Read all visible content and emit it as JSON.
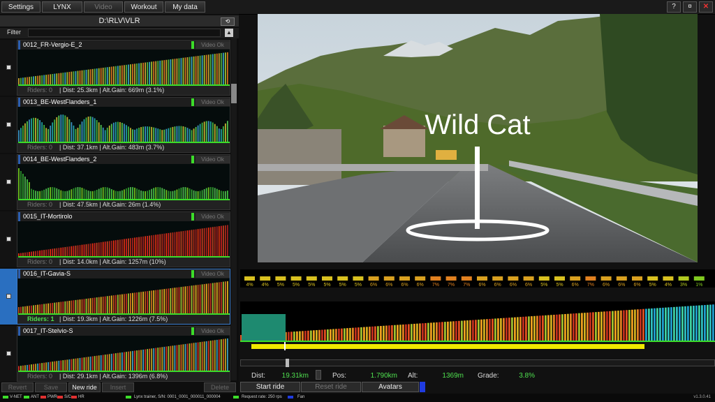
{
  "menu": {
    "settings": "Settings",
    "lynx": "LYNX",
    "video": "Video",
    "workout": "Workout",
    "mydata": "My data"
  },
  "window": {
    "help": "?",
    "minimize": "¤",
    "close": "✕"
  },
  "path": "D:\\RLV\\VLR",
  "filter": {
    "label": "Filter",
    "value": ""
  },
  "rides": [
    {
      "name": "0012_FR-Vergio-E_2",
      "video": "Video Ok",
      "riders": "Riders: 0",
      "info": "| Dist: 25.3km | Alt.Gain: 669m (3.1%)"
    },
    {
      "name": "0013_BE-WestFlanders_1",
      "video": "Video Ok",
      "riders": "Riders: 0",
      "info": "| Dist: 37.1km | Alt.Gain: 483m (3.7%)"
    },
    {
      "name": "0014_BE-WestFlanders_2",
      "video": "Video Ok",
      "riders": "Riders: 0",
      "info": "| Dist: 47.5km | Alt.Gain: 26m (1.4%)"
    },
    {
      "name": "0015_IT-Mortirolo",
      "video": "Video Ok",
      "riders": "Riders: 0",
      "info": "| Dist: 14.0km | Alt.Gain: 1257m (10%)"
    },
    {
      "name": "0016_IT-Gavia-S",
      "video": "Video Ok",
      "riders": "Riders: 1",
      "info": "| Dist: 19.3km | Alt.Gain: 1226m (7.5%)"
    },
    {
      "name": "0017_IT-Stelvio-S",
      "video": "Video Ok",
      "riders": "Riders: 0",
      "info": "| Dist: 29.1km | Alt.Gain: 1396m (6.8%)"
    }
  ],
  "bottom": {
    "revert": "Revert",
    "save": "Save",
    "newride": "New ride",
    "insert": "Insert",
    "delete": "Delete"
  },
  "status": {
    "vnet": "V-NET",
    "ant": "ANT",
    "pwr": "PWR",
    "sc": "S/C",
    "hr": "HR",
    "trainer": "Lynx trainer, S/N: 0001_0001_000011_000004",
    "rate": "Request rate: 250 rps",
    "fan": "Fan",
    "version": "v1.3.0.41"
  },
  "overlay": "Wild Cat",
  "grades": [
    "4%",
    "4%",
    "5%",
    "5%",
    "5%",
    "5%",
    "5%",
    "5%",
    "6%",
    "6%",
    "6%",
    "6%",
    "7%",
    "7%",
    "7%",
    "6%",
    "6%",
    "6%",
    "6%",
    "5%",
    "5%",
    "6%",
    "7%",
    "6%",
    "6%",
    "6%",
    "5%",
    "4%",
    "3%",
    "1%"
  ],
  "metrics": {
    "dist_label": "Dist:",
    "dist": "19.31km",
    "pos_label": "Pos:",
    "pos": "1.790km",
    "alt_label": "Alt:",
    "alt": "1369m",
    "grade_label": "Grade:",
    "grade": "3.8%"
  },
  "actions": {
    "start": "Start ride",
    "reset": "Reset ride",
    "avatars": "Avatars"
  },
  "progress": {
    "position_km": 1.79,
    "distance_km": 19.31
  }
}
